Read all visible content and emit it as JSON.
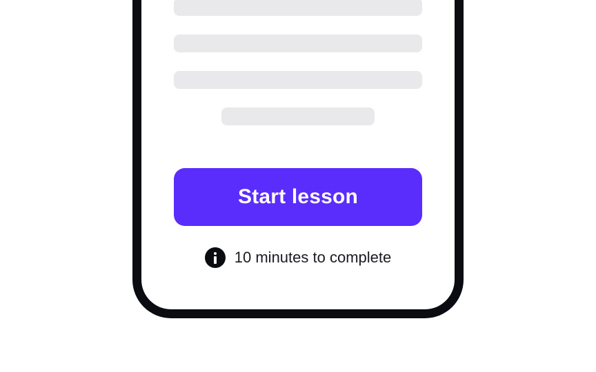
{
  "lesson": {
    "start_button_label": "Start lesson",
    "duration_text": "10 minutes to complete",
    "info_icon": "info-icon"
  },
  "colors": {
    "accent": "#5a2dfd",
    "frame": "#0b0b12",
    "skeleton": "#e9e9eb",
    "background": "#ffffff"
  }
}
